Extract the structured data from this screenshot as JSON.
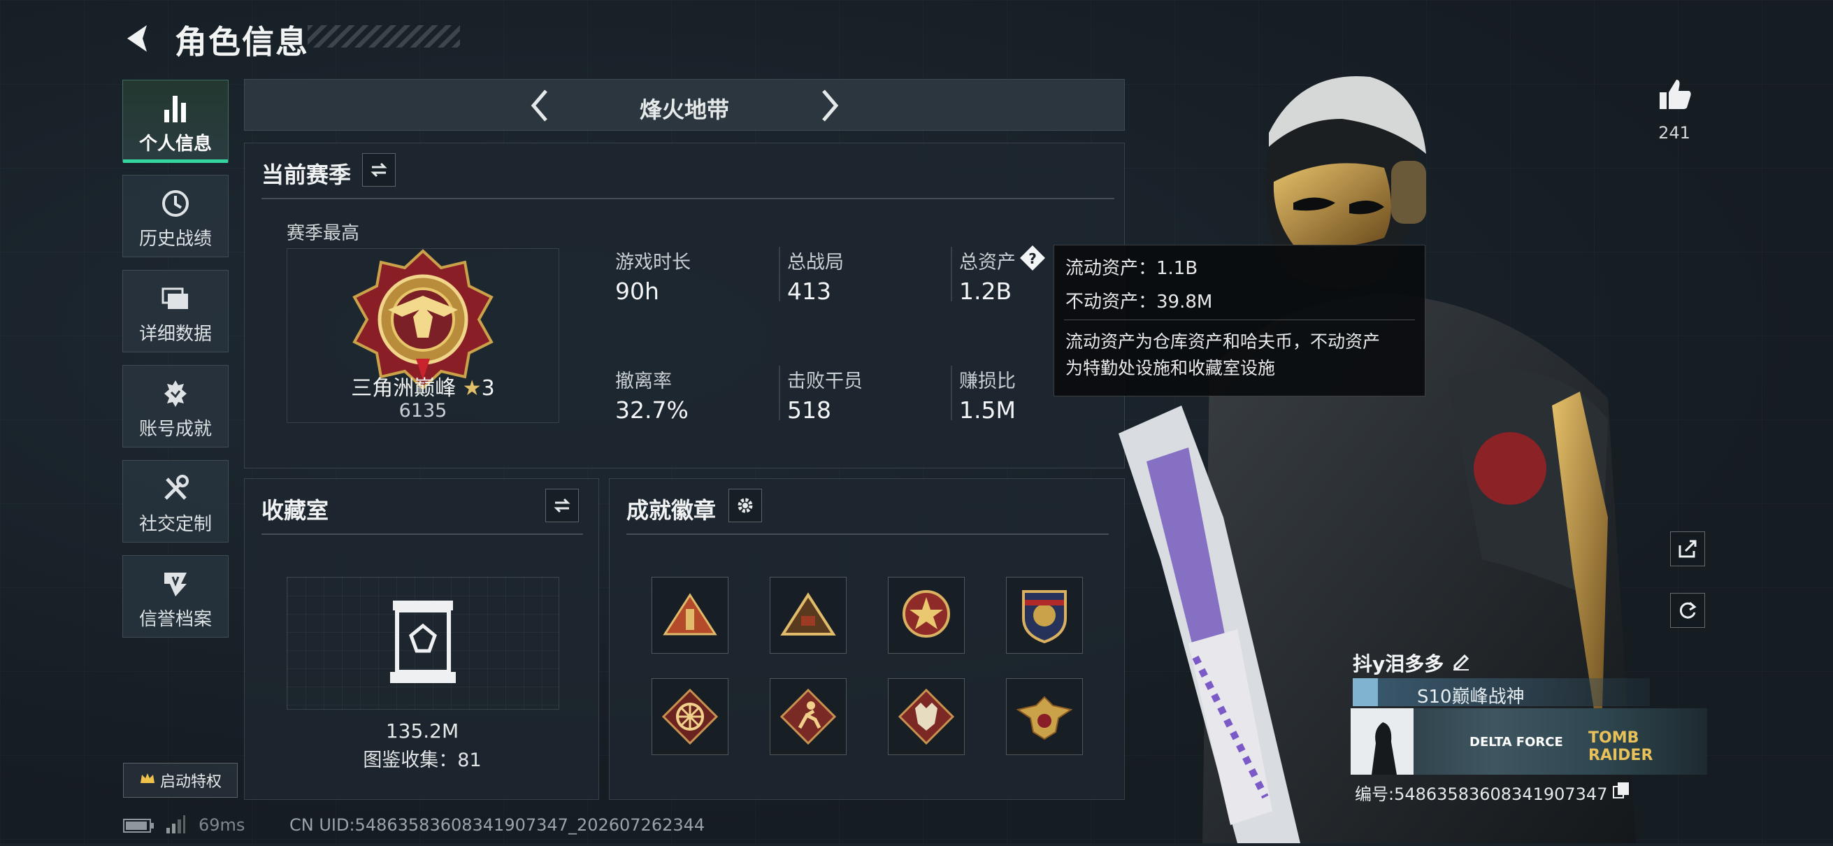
{
  "header": {
    "title": "角色信息"
  },
  "sidebar": {
    "items": [
      {
        "label": "个人信息",
        "icon": "bar-chart-icon"
      },
      {
        "label": "历史战绩",
        "icon": "clock-icon"
      },
      {
        "label": "详细数据",
        "icon": "cards-icon"
      },
      {
        "label": "账号成就",
        "icon": "medal-icon"
      },
      {
        "label": "社交定制",
        "icon": "tools-icon"
      },
      {
        "label": "信誉档案",
        "icon": "shield-icon"
      }
    ],
    "privilege_label": "启动特权"
  },
  "mode": {
    "title": "烽火地带"
  },
  "season": {
    "title": "当前赛季",
    "best_label": "赛季最高",
    "rank_name": "三角洲巅峰",
    "rank_stars": "3",
    "rank_score": "6135",
    "stats": [
      {
        "label": "游戏时长",
        "value": "90h"
      },
      {
        "label": "总战局",
        "value": "413"
      },
      {
        "label": "总资产",
        "value": "1.2B"
      },
      {
        "label": "撤离率",
        "value": "32.7%"
      },
      {
        "label": "击败干员",
        "value": "518"
      },
      {
        "label": "赚损比",
        "value": "1.5M"
      }
    ]
  },
  "tooltip": {
    "liquid": "流动资产：1.1B",
    "fixed": "不动资产：39.8M",
    "desc_line1": "流动资产为仓库资产和哈夫币，不动资产",
    "desc_line2": "为特勤处设施和收藏室设施"
  },
  "collection": {
    "title": "收藏室",
    "value": "135.2M",
    "count_text": "图鉴收集：81"
  },
  "achievements": {
    "title": "成就徽章",
    "badges": [
      "triangle-badge",
      "pyramid-badge",
      "star-emblem-badge",
      "shield-badge",
      "wheel-badge",
      "runner-badge",
      "wolf-badge",
      "eagle-badge"
    ]
  },
  "likes": {
    "count": "241"
  },
  "player": {
    "name": "抖y泪多多",
    "title": "S10巅峰战神",
    "card_brand_1": "DELTA FORCE",
    "card_brand_2": "TOMB RAIDER",
    "id_text": "编号:548635836083419073​47"
  },
  "footer": {
    "ping": "69ms",
    "uid": "CN UID:548635836083419073​47_202607262344"
  },
  "colors": {
    "accent": "#34d6a0",
    "gold": "#c9a24a",
    "bg": "#1a222a"
  }
}
